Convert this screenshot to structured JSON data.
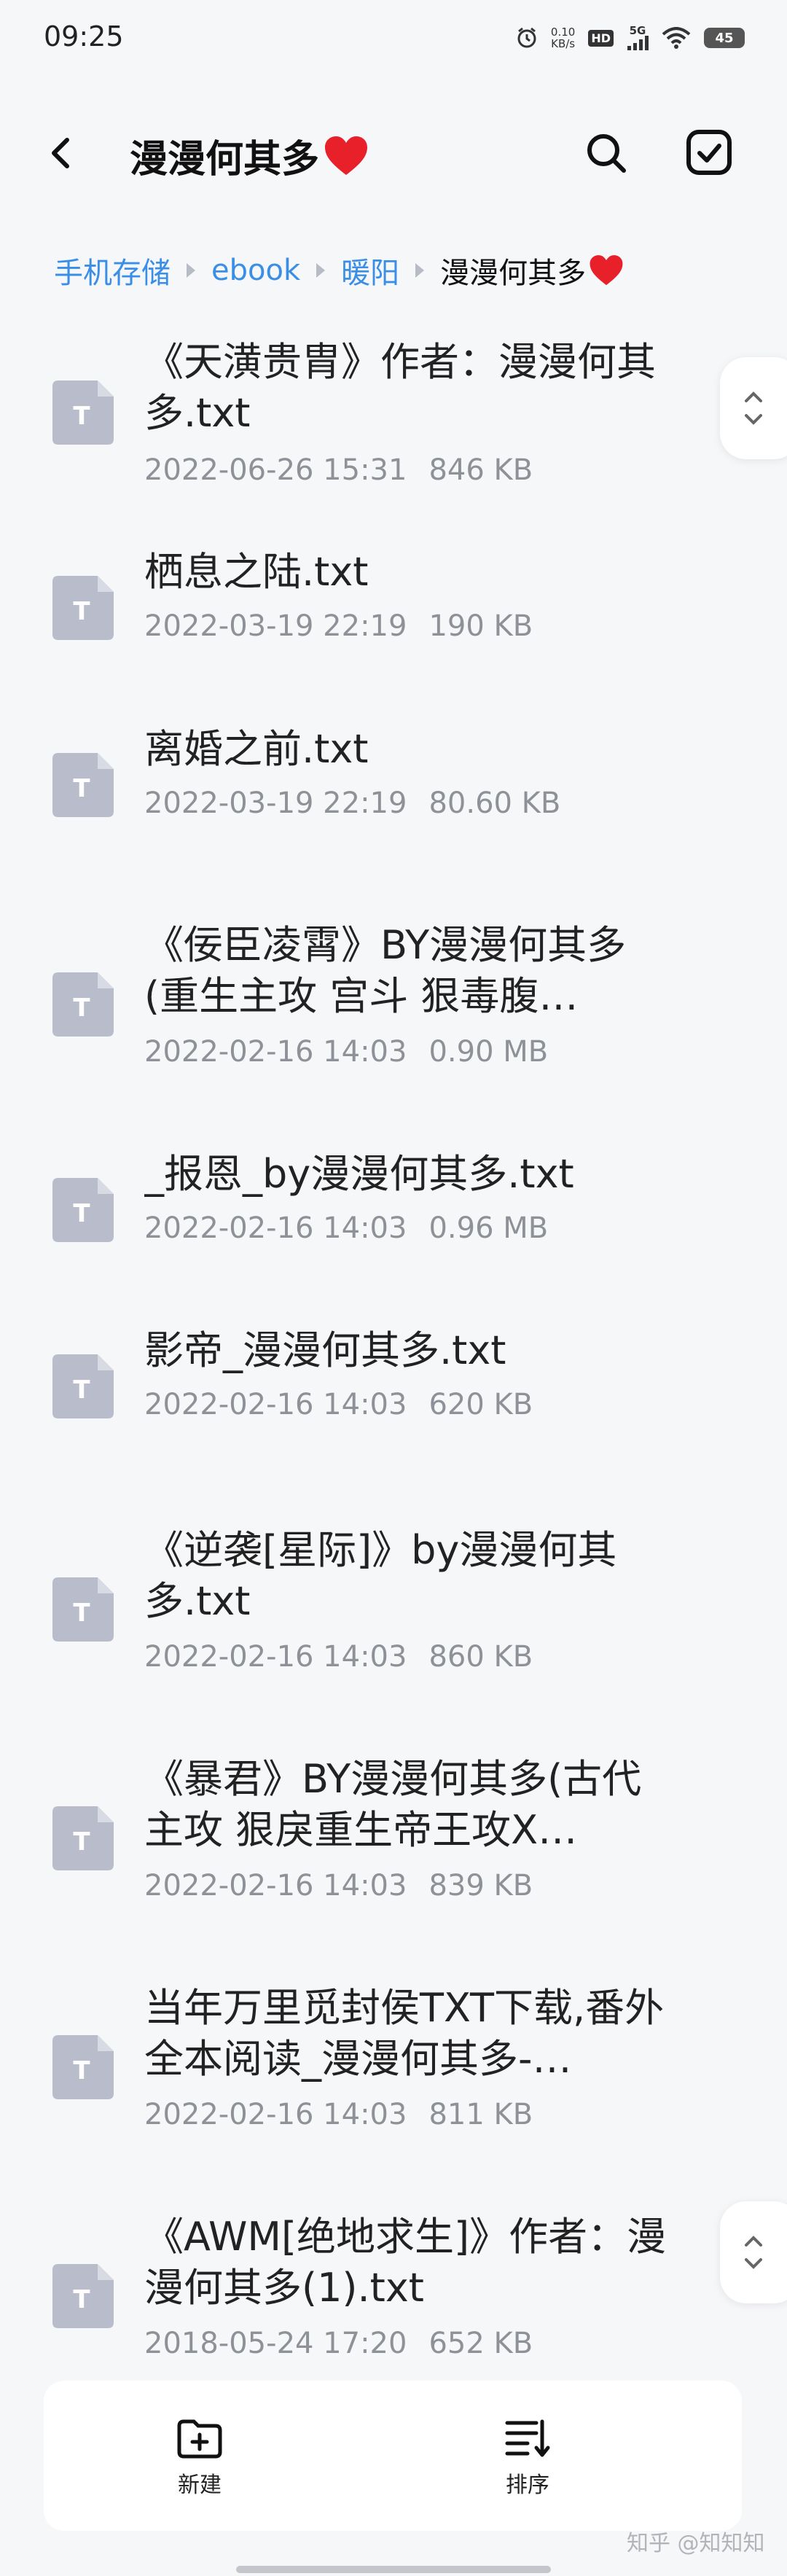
{
  "status_bar": {
    "time": "09:25",
    "net_speed_value": "0.10",
    "net_speed_unit": "KB/s",
    "hd": "HD",
    "network": "5G",
    "battery": "45"
  },
  "header": {
    "title": "漫漫何其多",
    "title_emoji": "heart-icon"
  },
  "breadcrumb": [
    "手机存储",
    "ebook",
    "暖阳",
    "漫漫何其多"
  ],
  "files": [
    {
      "name": "《天潢贵胄》作者：漫漫何其多.txt",
      "date": "2022-06-26 15:31",
      "size": "846 KB"
    },
    {
      "name": "栖息之陆.txt",
      "date": "2022-03-19 22:19",
      "size": "190 KB"
    },
    {
      "name": "离婚之前.txt",
      "date": "2022-03-19 22:19",
      "size": "80.60 KB"
    },
    {
      "name": "《佞臣凌霄》BY漫漫何其多 (重生主攻 宫斗 狠毒腹…",
      "date": "2022-02-16 14:03",
      "size": "0.90 MB"
    },
    {
      "name": "_报恩_by漫漫何其多.txt",
      "date": "2022-02-16 14:03",
      "size": "0.96 MB"
    },
    {
      "name": "影帝_漫漫何其多.txt",
      "date": "2022-02-16 14:03",
      "size": "620 KB"
    },
    {
      "name": "《逆袭[星际]》by漫漫何其多.txt",
      "date": "2022-02-16 14:03",
      "size": "860 KB"
    },
    {
      "name": "《暴君》BY漫漫何其多(古代 主攻 狠戾重生帝王攻X…",
      "date": "2022-02-16 14:03",
      "size": "839 KB"
    },
    {
      "name": "当年万里觅封侯TXT下载,番外全本阅读_漫漫何其多-…",
      "date": "2022-02-16 14:03",
      "size": "811 KB"
    },
    {
      "name": "《AWM[绝地求生]》作者：漫漫何其多(1).txt",
      "date": "2018-05-24 17:20",
      "size": "652 KB"
    }
  ],
  "file_icon_letter": "T",
  "bottom_bar": {
    "new_label": "新建",
    "sort_label": "排序"
  },
  "watermark": "知乎 @知知知",
  "colors": {
    "accent": "#3a8ee6",
    "heart": "#e8202a",
    "file_icon": "#b8bccb"
  }
}
